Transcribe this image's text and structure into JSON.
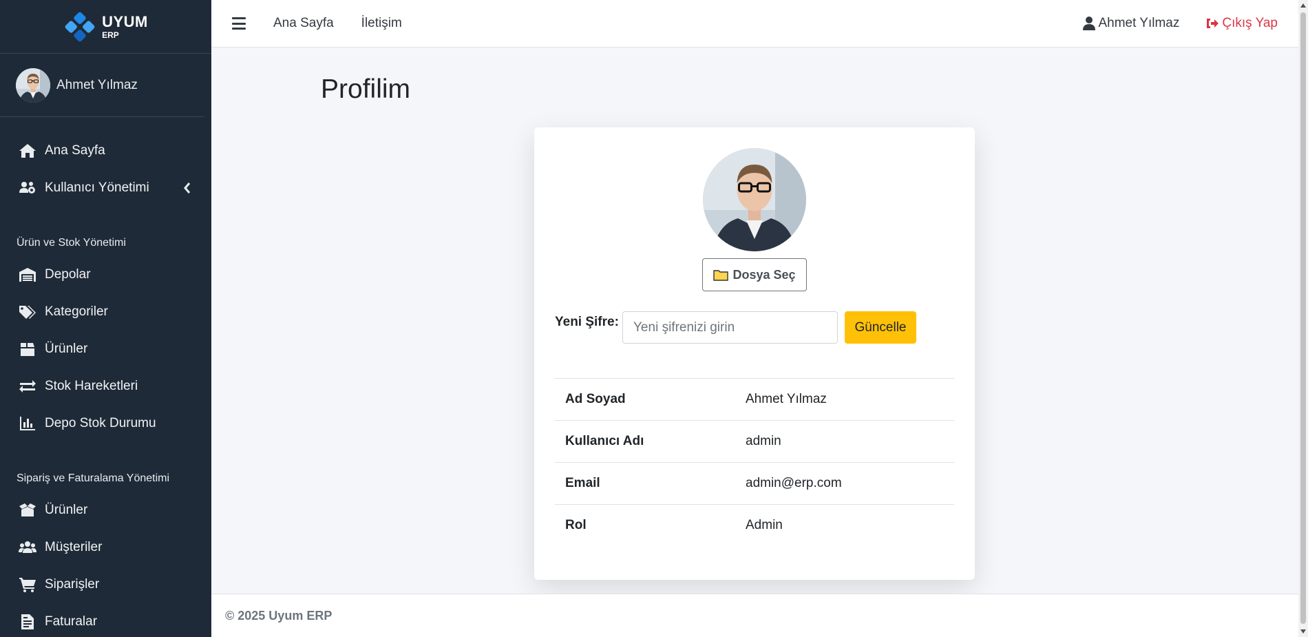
{
  "brand": {
    "name": "UYUM",
    "sub": "ERP"
  },
  "sidebar": {
    "user_name": "Ahmet Yılmaz",
    "items_top": [
      {
        "label": "Ana Sayfa",
        "icon": "home-icon"
      },
      {
        "label": "Kullanıcı Yönetimi",
        "icon": "users-cog-icon"
      }
    ],
    "section1_header": "Ürün ve Stok Yönetimi",
    "items_stock": [
      {
        "label": "Depolar",
        "icon": "warehouse-icon"
      },
      {
        "label": "Kategoriler",
        "icon": "tags-icon"
      },
      {
        "label": "Ürünler",
        "icon": "box-icon"
      },
      {
        "label": "Stok Hareketleri",
        "icon": "exchange-icon"
      },
      {
        "label": "Depo Stok Durumu",
        "icon": "chart-bar-icon"
      }
    ],
    "section2_header": "Sipariş ve Faturalama Yönetimi",
    "items_orders": [
      {
        "label": "Ürünler",
        "icon": "box-open-icon"
      },
      {
        "label": "Müşteriler",
        "icon": "users-icon"
      },
      {
        "label": "Siparişler",
        "icon": "cart-icon"
      },
      {
        "label": "Faturalar",
        "icon": "invoice-icon"
      }
    ]
  },
  "topbar": {
    "links": [
      "Ana Sayfa",
      "İletişim"
    ],
    "user": "Ahmet Yılmaz",
    "logout": "Çıkış Yap"
  },
  "page": {
    "title": "Profilim",
    "file_button": "Dosya Seç",
    "password_label": "Yeni Şifre:",
    "password_placeholder": "Yeni şifrenizi girin",
    "update_button": "Güncelle",
    "info": [
      {
        "key": "Ad Soyad",
        "value": "Ahmet Yılmaz"
      },
      {
        "key": "Kullanıcı Adı",
        "value": "admin"
      },
      {
        "key": "Email",
        "value": "admin@erp.com"
      },
      {
        "key": "Rol",
        "value": "Admin"
      }
    ]
  },
  "footer": {
    "text": "© 2025 Uyum ERP"
  },
  "colors": {
    "sidebar_bg": "#1f2a38",
    "accent_warning": "#ffc107",
    "danger": "#dc3545",
    "logo_blue": "#1e88e5"
  }
}
